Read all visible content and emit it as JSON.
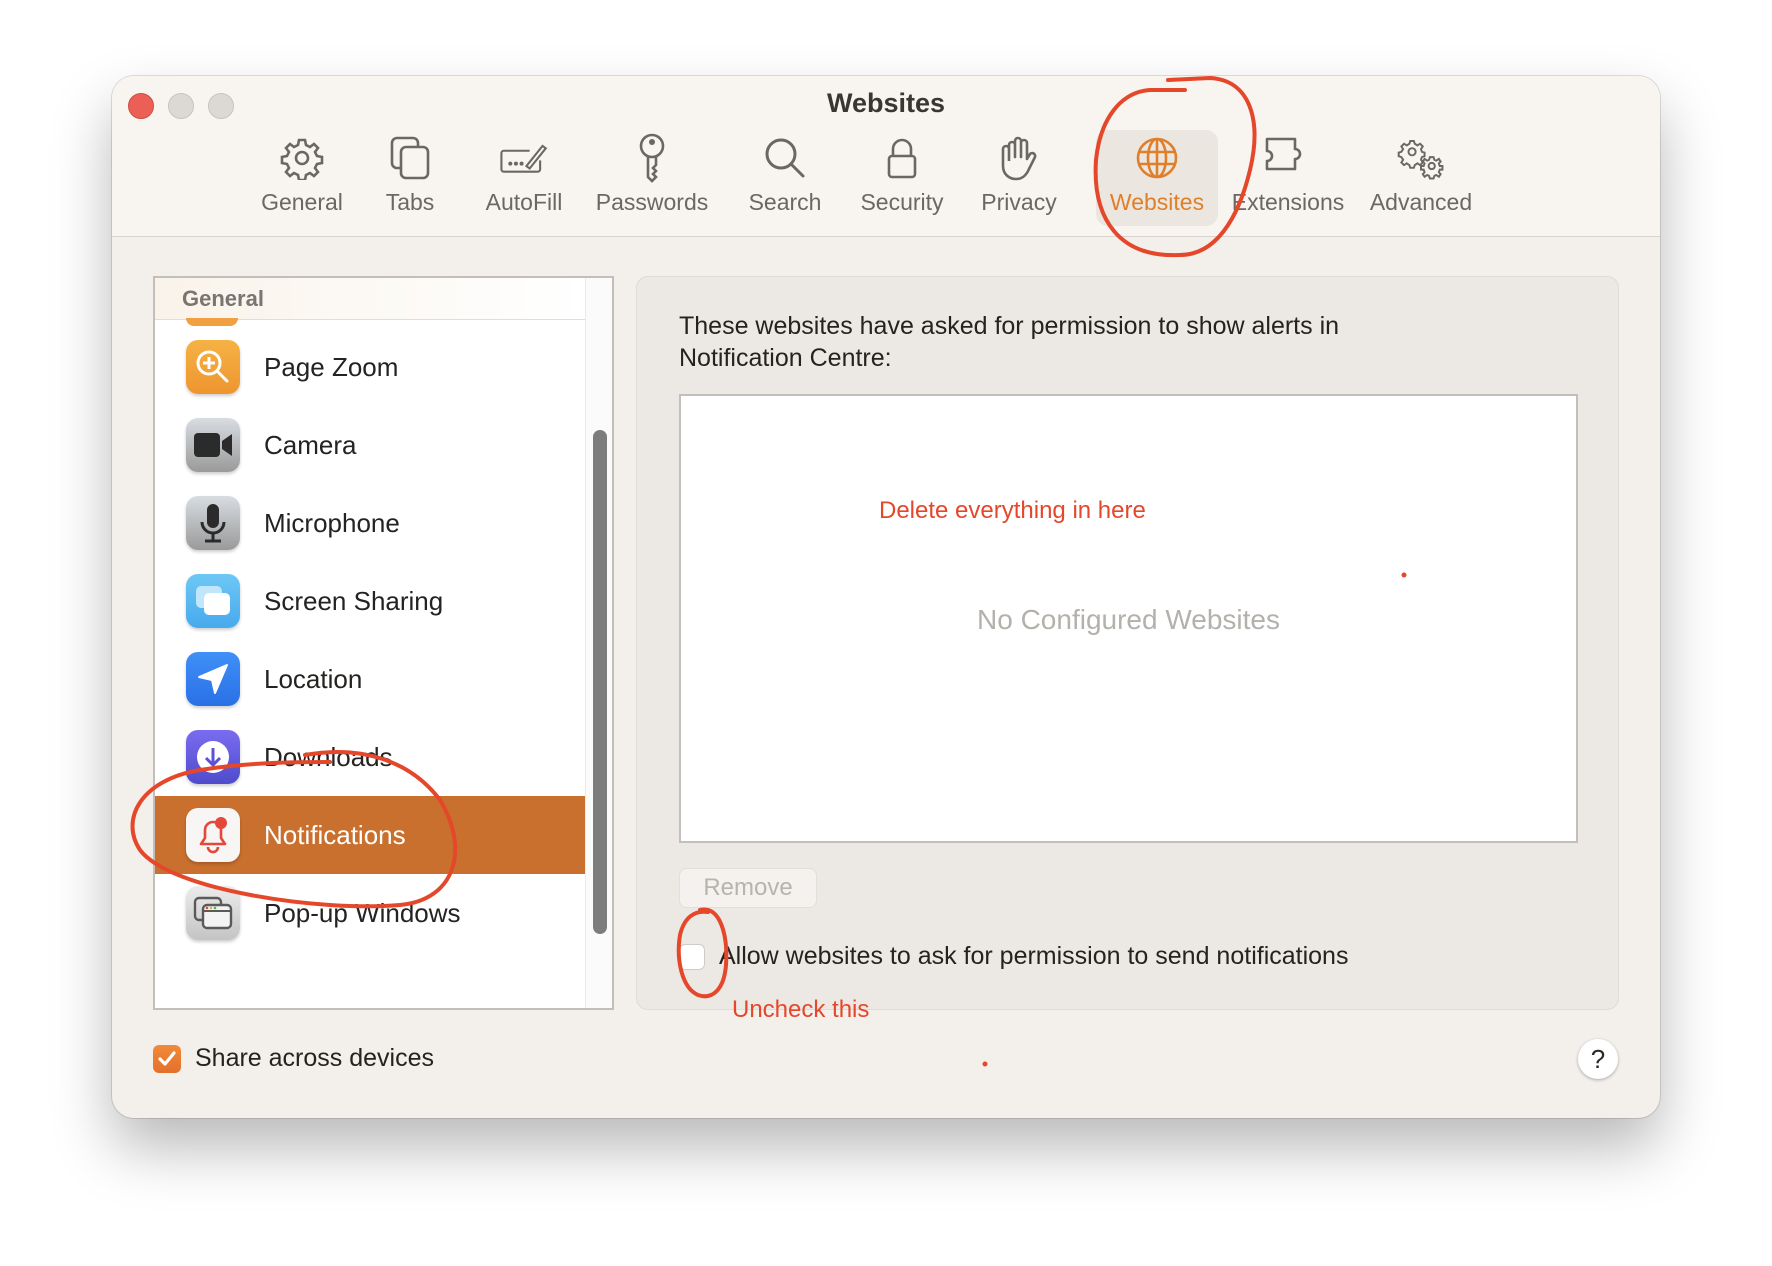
{
  "window": {
    "title": "Websites",
    "traffic_lights": [
      "close",
      "minimize",
      "zoom"
    ]
  },
  "toolbar": {
    "items": [
      {
        "label": "General",
        "icon": "gear-icon"
      },
      {
        "label": "Tabs",
        "icon": "tabs-icon"
      },
      {
        "label": "AutoFill",
        "icon": "autofill-icon"
      },
      {
        "label": "Passwords",
        "icon": "key-icon"
      },
      {
        "label": "Search",
        "icon": "search-icon"
      },
      {
        "label": "Security",
        "icon": "lock-icon"
      },
      {
        "label": "Privacy",
        "icon": "hand-icon"
      },
      {
        "label": "Websites",
        "icon": "globe-icon",
        "active": true
      },
      {
        "label": "Extensions",
        "icon": "puzzle-icon"
      },
      {
        "label": "Advanced",
        "icon": "gears-icon"
      }
    ],
    "accent_color": "#e07f2a"
  },
  "sidebar": {
    "section_header": "General",
    "items": [
      {
        "label": "Page Zoom",
        "icon": "page-zoom-icon"
      },
      {
        "label": "Camera",
        "icon": "camera-icon"
      },
      {
        "label": "Microphone",
        "icon": "microphone-icon"
      },
      {
        "label": "Screen Sharing",
        "icon": "screen-sharing-icon"
      },
      {
        "label": "Location",
        "icon": "location-icon"
      },
      {
        "label": "Downloads",
        "icon": "downloads-icon"
      },
      {
        "label": "Notifications",
        "icon": "notifications-icon",
        "selected": true
      },
      {
        "label": "Pop-up Windows",
        "icon": "popup-windows-icon"
      }
    ],
    "selection_color": "#c9702e"
  },
  "panel": {
    "description": "These websites have asked for permission to show alerts in Notification Centre:",
    "empty_message": "No Configured Websites",
    "remove_button": "Remove",
    "allow_checkbox": {
      "label": "Allow websites to ask for permission to send notifications",
      "checked": false
    }
  },
  "footer": {
    "share_checkbox": {
      "label": "Share across devices",
      "checked": true
    },
    "help_button": "?"
  },
  "annotations": {
    "delete_note": "Delete everything in here",
    "uncheck_note": "Uncheck this",
    "color": "#e5472b"
  }
}
